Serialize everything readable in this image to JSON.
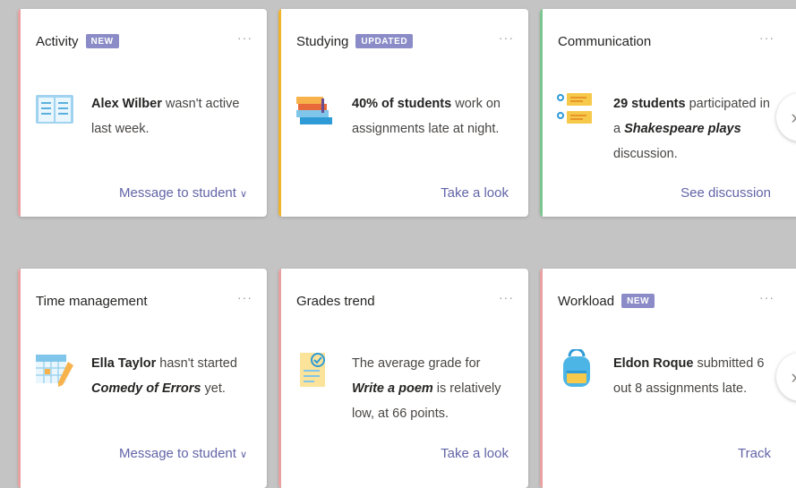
{
  "colors": {
    "accent": "#6264a7",
    "badge": "#8b8cc7",
    "red_bar": "#e8a0a0",
    "yellow_bar": "#f0b429",
    "green_bar": "#7cc68f"
  },
  "cards": [
    {
      "title": "Activity",
      "badge": "NEW",
      "more": "···",
      "icon": "book-icon",
      "name": "Alex Wilber",
      "text": " wasn't active last week.",
      "action": "Message to student",
      "action_chevron": "∨"
    },
    {
      "title": "Studying",
      "badge": "UPDATED",
      "more": "···",
      "icon": "books-stack-icon",
      "name": "40% of students",
      "text": " work on assignments late at night.",
      "action": "Take a look"
    },
    {
      "title": "Communication",
      "more": "···",
      "icon": "discussion-icon",
      "name": "29 students",
      "text_a": " participated in a ",
      "italic": "Shakespeare plays",
      "text_b": " discussion.",
      "action": "See discussion"
    },
    {
      "title": "Time management",
      "more": "···",
      "icon": "calendar-icon",
      "name": "Ella Taylor",
      "text_a": " hasn't started ",
      "italic": "Comedy of Errors",
      "text_b": " yet.",
      "action": "Message to student",
      "action_chevron": "∨"
    },
    {
      "title": "Grades trend",
      "more": "···",
      "icon": "graded-paper-icon",
      "text_a": "The average grade for ",
      "italic": "Write a poem",
      "text_b": " is relatively low, at 66 points.",
      "action": "Take a look"
    },
    {
      "title": "Workload",
      "badge": "NEW",
      "more": "···",
      "icon": "backpack-icon",
      "name": "Eldon Roque",
      "text": " submitted 6 out 8 assignments late.",
      "action": "Track"
    }
  ],
  "scroll_next": "›"
}
